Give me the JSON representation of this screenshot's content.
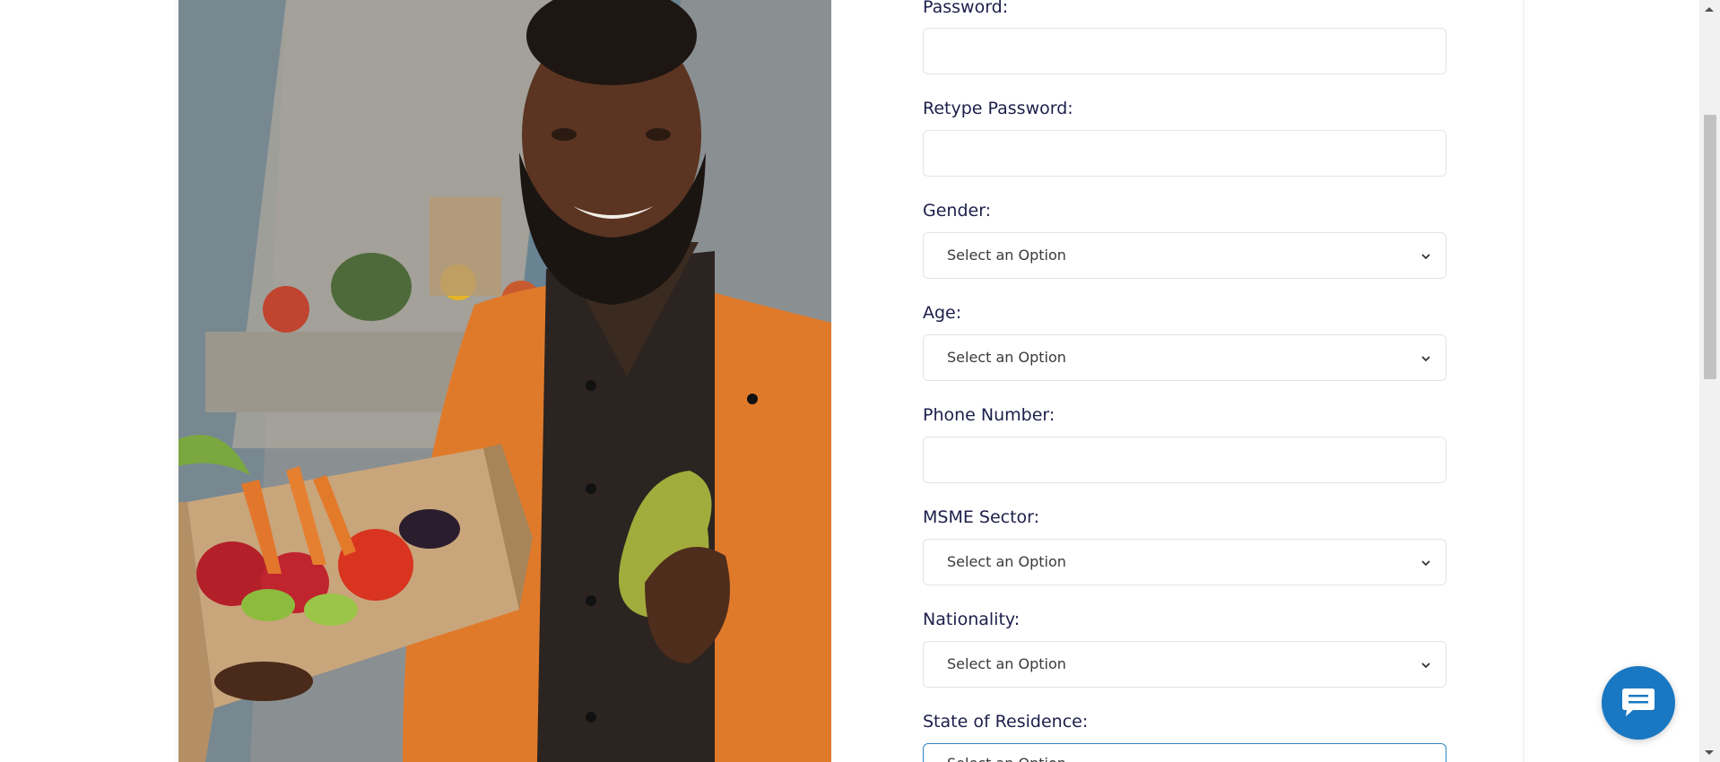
{
  "form": {
    "password": {
      "label": "Password:",
      "value": ""
    },
    "retype_password": {
      "label": "Retype Password:",
      "value": ""
    },
    "gender": {
      "label": "Gender:",
      "selected": "Select an Option"
    },
    "age": {
      "label": "Age:",
      "selected": "Select an Option"
    },
    "phone_number": {
      "label": "Phone Number:",
      "value": ""
    },
    "msme_sector": {
      "label": "MSME Sector:",
      "selected": "Select an Option"
    },
    "nationality": {
      "label": "Nationality:",
      "selected": "Select an Option"
    },
    "state_of_residence": {
      "label": "State of Residence:",
      "selected": "Select an Option"
    }
  },
  "colors": {
    "label": "#1c1f4a",
    "accent": "#1a78c2",
    "focus_border": "#2d86c4",
    "field_border": "#e1e4ea"
  },
  "icons": {
    "chevron": "chevron-down-icon",
    "chat": "chat-bubble-icon"
  }
}
